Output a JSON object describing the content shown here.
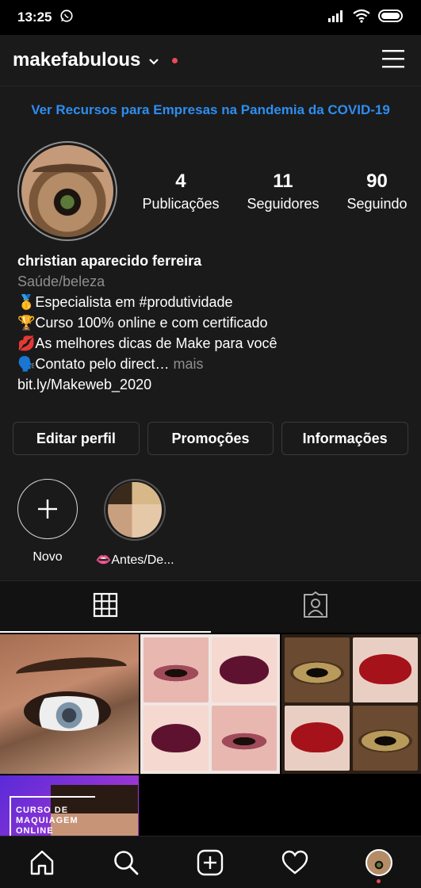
{
  "status_bar": {
    "time": "13:25"
  },
  "header": {
    "username": "makefabulous"
  },
  "banner": {
    "text": "Ver Recursos para Empresas na Pandemia da COVID-19"
  },
  "profile": {
    "stats": [
      {
        "value": "4",
        "label": "Publicações"
      },
      {
        "value": "11",
        "label": "Seguidores"
      },
      {
        "value": "90",
        "label": "Seguindo"
      }
    ],
    "name": "christian aparecido ferreira",
    "category": "Saúde/beleza",
    "bio_lines": [
      "🥇Especialista em #produtividade",
      "🏆Curso 100% online e com certificado",
      "💋As melhores dicas de Make para você",
      "🗣️Contato pelo direct…"
    ],
    "bio_more": " mais",
    "link": "bit.ly/Makeweb_2020"
  },
  "buttons": {
    "edit": "Editar perfil",
    "promotions": "Promoções",
    "info": "Informações"
  },
  "highlights": [
    {
      "label": "Novo"
    },
    {
      "label": "👄Antes/De..."
    }
  ],
  "posts": {
    "course_text": "CURSO DE MAQUIAGEM ONLINE"
  },
  "colors": {
    "accent": "#2d8ef0",
    "notification": "#ed4956",
    "background": "#121212"
  }
}
